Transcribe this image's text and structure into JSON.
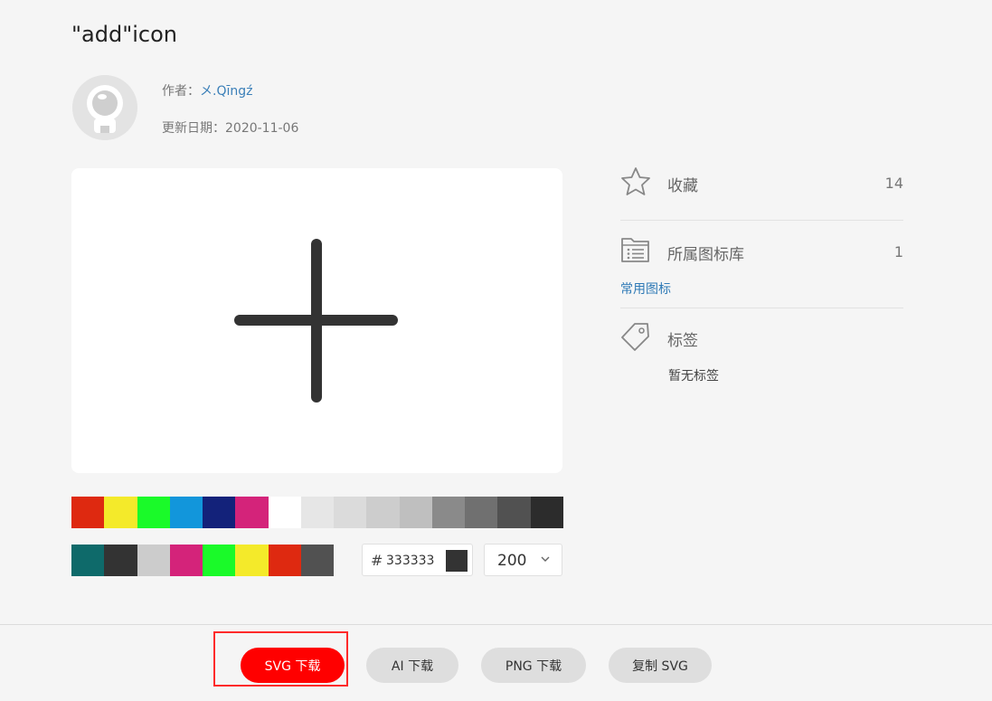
{
  "icon": {
    "title": "\"add\"icon"
  },
  "author": {
    "label": "作者：",
    "name": "メ.Qīngź",
    "avatar_icon": "astronaut-avatar-icon"
  },
  "updated": {
    "label": "更新日期：",
    "date": "2020-11-06"
  },
  "preview": {
    "glyph": "plus-icon",
    "stroke_color": "#333333"
  },
  "palette": {
    "row1": [
      "#de2910",
      "#f4ea2a",
      "#1afa29",
      "#1296db",
      "#13227a",
      "#d4237a",
      "#ffffff",
      "#e6e6e6",
      "#dbdbdb",
      "#cdcdcd",
      "#bfbfbf",
      "#8a8a8a",
      "#707070",
      "#515151",
      "#2c2c2c"
    ],
    "row2": [
      "#0e6a6a",
      "#333333",
      "#cccccc",
      "#d4237a",
      "#1afa29",
      "#f4ea2a",
      "#de2910",
      "#515151"
    ]
  },
  "color_input": {
    "hash": "#",
    "value": "333333",
    "swatch_color": "#333333"
  },
  "size_select": {
    "value": "200"
  },
  "sidebar": {
    "favorites": {
      "label": "收藏",
      "count": "14",
      "icon": "star-icon"
    },
    "library": {
      "label": "所属图标库",
      "count": "1",
      "icon": "folder-list-icon",
      "link": "常用图标"
    },
    "tags": {
      "label": "标签",
      "icon": "tag-icon",
      "empty_text": "暂无标签"
    }
  },
  "buttons": {
    "svg_download": "SVG 下载",
    "ai_download": "AI 下载",
    "png_download": "PNG 下载",
    "copy_svg": "复制 SVG"
  },
  "accent_color": "#ff0000",
  "link_color": "#2f7ab6"
}
